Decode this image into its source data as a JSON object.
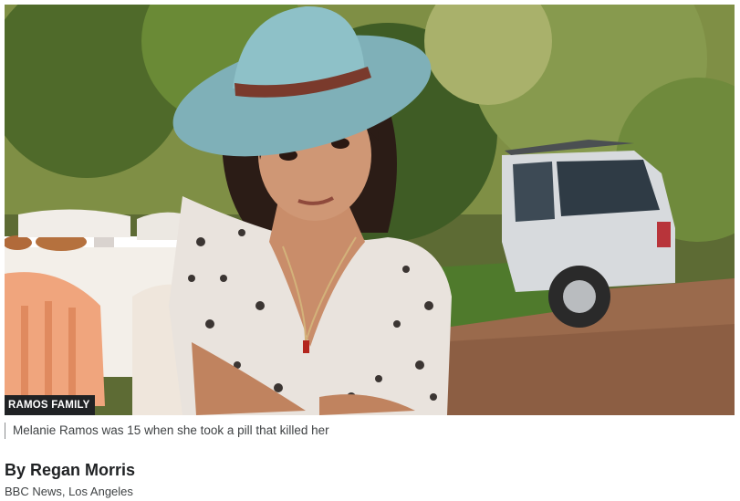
{
  "image": {
    "credit": "RAMOS FAMILY",
    "caption": "Melanie Ramos was 15 when she took a pill that killed her"
  },
  "byline": {
    "author": "By Regan Morris",
    "organization": "BBC News, Los Angeles"
  }
}
